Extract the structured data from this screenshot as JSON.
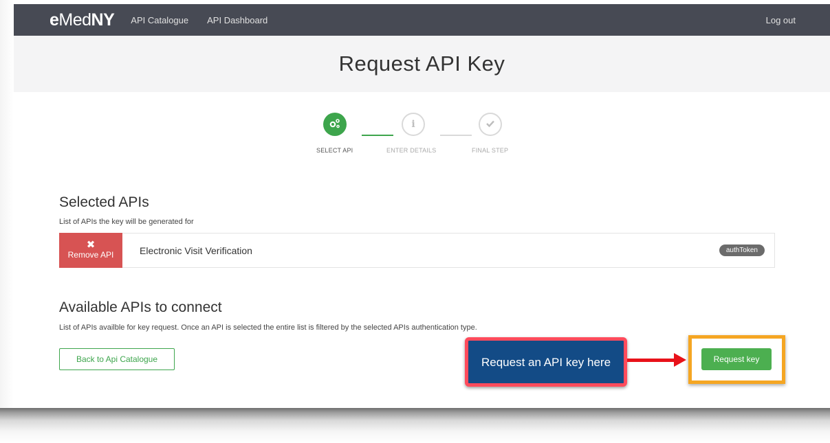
{
  "navbar": {
    "brand_prefix": "e",
    "brand_mid": "Med",
    "brand_suffix": "NY",
    "links": [
      "API Catalogue",
      "API Dashboard"
    ],
    "logout": "Log out"
  },
  "page": {
    "title": "Request API Key"
  },
  "stepper": {
    "steps": [
      {
        "label": "SELECT API",
        "icon": "gears-icon",
        "state": "active"
      },
      {
        "label": "ENTER DETAILS",
        "icon": "info-icon",
        "state": "inactive"
      },
      {
        "label": "FINAL STEP",
        "icon": "check-icon",
        "state": "inactive"
      }
    ]
  },
  "selected": {
    "title": "Selected APIs",
    "description": "List of APIs the key will be generated for",
    "items": [
      {
        "remove_label": "Remove API",
        "name": "Electronic Visit Verification",
        "badge": "authToken"
      }
    ]
  },
  "available": {
    "title": "Available APIs to connect",
    "description": "List of APIs availble for key request. Once an API is selected the entire list is filtered by the selected APIs authentication type."
  },
  "actions": {
    "back_label": "Back to Api Catalogue",
    "request_label": "Request key"
  },
  "annotation": {
    "callout_text": "Request an API key here"
  },
  "colors": {
    "navbar": "#474a54",
    "accent_green": "#3da54c",
    "remove_red": "#d75353",
    "callout_blue": "#134b86",
    "callout_border": "#ff4b5c",
    "highlight_orange": "#f5a623",
    "arrow_red": "#e8121a"
  }
}
